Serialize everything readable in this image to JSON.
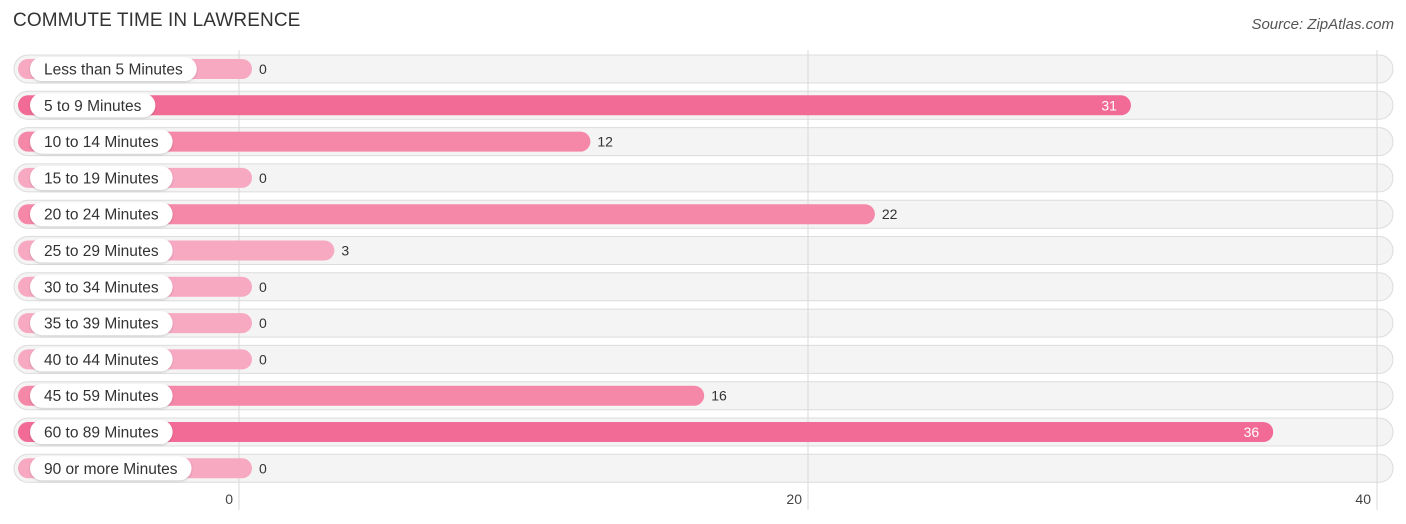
{
  "header": {
    "title": "COMMUTE TIME IN LAWRENCE",
    "source": "Source: ZipAtlas.com"
  },
  "colors": {
    "strong": "#f26b96",
    "medium": "#f587a8",
    "light": "#f7a9c2",
    "track": "#f4f4f4"
  },
  "chart_data": {
    "type": "bar",
    "orientation": "horizontal",
    "title": "COMMUTE TIME IN LAWRENCE",
    "source": "Source: ZipAtlas.com",
    "xlabel": "",
    "ylabel": "",
    "xlim": [
      0,
      40
    ],
    "x_ticks": [
      "0",
      "20",
      "40"
    ],
    "grid": true,
    "categories": [
      "Less than 5 Minutes",
      "5 to 9 Minutes",
      "10 to 14 Minutes",
      "15 to 19 Minutes",
      "20 to 24 Minutes",
      "25 to 29 Minutes",
      "30 to 34 Minutes",
      "35 to 39 Minutes",
      "40 to 44 Minutes",
      "45 to 59 Minutes",
      "60 to 89 Minutes",
      "90 or more Minutes"
    ],
    "values": [
      0,
      31,
      12,
      0,
      22,
      3,
      0,
      0,
      0,
      16,
      36,
      0
    ],
    "value_labels": [
      "0",
      "31",
      "12",
      "0",
      "22",
      "3",
      "0",
      "0",
      "0",
      "16",
      "36",
      "0"
    ]
  }
}
